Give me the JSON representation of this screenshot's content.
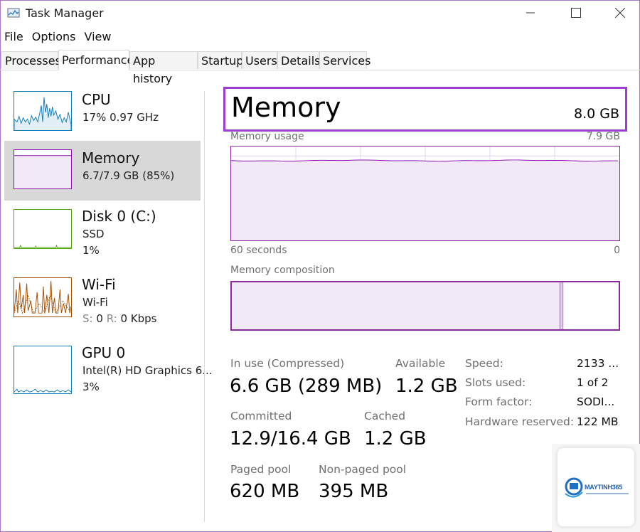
{
  "window": {
    "title": "Task Manager"
  },
  "menu": [
    "File",
    "Options",
    "View"
  ],
  "tabs": [
    "Processes",
    "Performance",
    "App history",
    "Startup",
    "Users",
    "Details",
    "Services"
  ],
  "active_tab": "Performance",
  "sidebar": [
    {
      "title": "CPU",
      "line1": "17%  0.97 GHz",
      "line2": "",
      "color": "#117dbb"
    },
    {
      "title": "Memory",
      "line1": "6.7/7.9 GB (85%)",
      "line2": "",
      "color": "#8b12ae"
    },
    {
      "title": "Disk 0 (C:)",
      "line1": "SSD",
      "line2": "1%",
      "color": "#4da60c"
    },
    {
      "title": "Wi-Fi",
      "line1": "Wi-Fi",
      "line2_s": "S:",
      "line2_sv": "0",
      "line2_r": "R:",
      "line2_rv": "0 Kbps",
      "color": "#a74f01"
    },
    {
      "title": "GPU 0",
      "line1": "Intel(R) HD Graphics 6...",
      "line2": "3%",
      "color": "#117dbb"
    }
  ],
  "main": {
    "title": "Memory",
    "total": "8.0 GB",
    "usage_label": "Memory usage",
    "usage_max": "7.9 GB",
    "time_left": "60 seconds",
    "time_right": "0",
    "usage_level": 0.85,
    "composition_label": "Memory composition",
    "composition": {
      "in_use_fraction": 0.848,
      "modified_fraction": 0.008
    },
    "stats": {
      "in_use_label": "In use (Compressed)",
      "in_use_value": "6.6 GB (289 MB)",
      "available_label": "Available",
      "available_value": "1.2 GB",
      "committed_label": "Committed",
      "committed_value": "12.9/16.4 GB",
      "cached_label": "Cached",
      "cached_value": "1.2 GB",
      "paged_label": "Paged pool",
      "paged_value": "620 MB",
      "nonpaged_label": "Non-paged pool",
      "nonpaged_value": "395 MB"
    },
    "specs": [
      {
        "label": "Speed:",
        "value": "2133 ..."
      },
      {
        "label": "Slots used:",
        "value": "1 of 2"
      },
      {
        "label": "Form factor:",
        "value": "SODI..."
      },
      {
        "label": "Hardware reserved:",
        "value": "122 MB"
      }
    ]
  },
  "watermark": {
    "brand": "MAYTINH365"
  },
  "colors": {
    "accent": "#8b12ae",
    "highlight": "#9b3fd1"
  }
}
